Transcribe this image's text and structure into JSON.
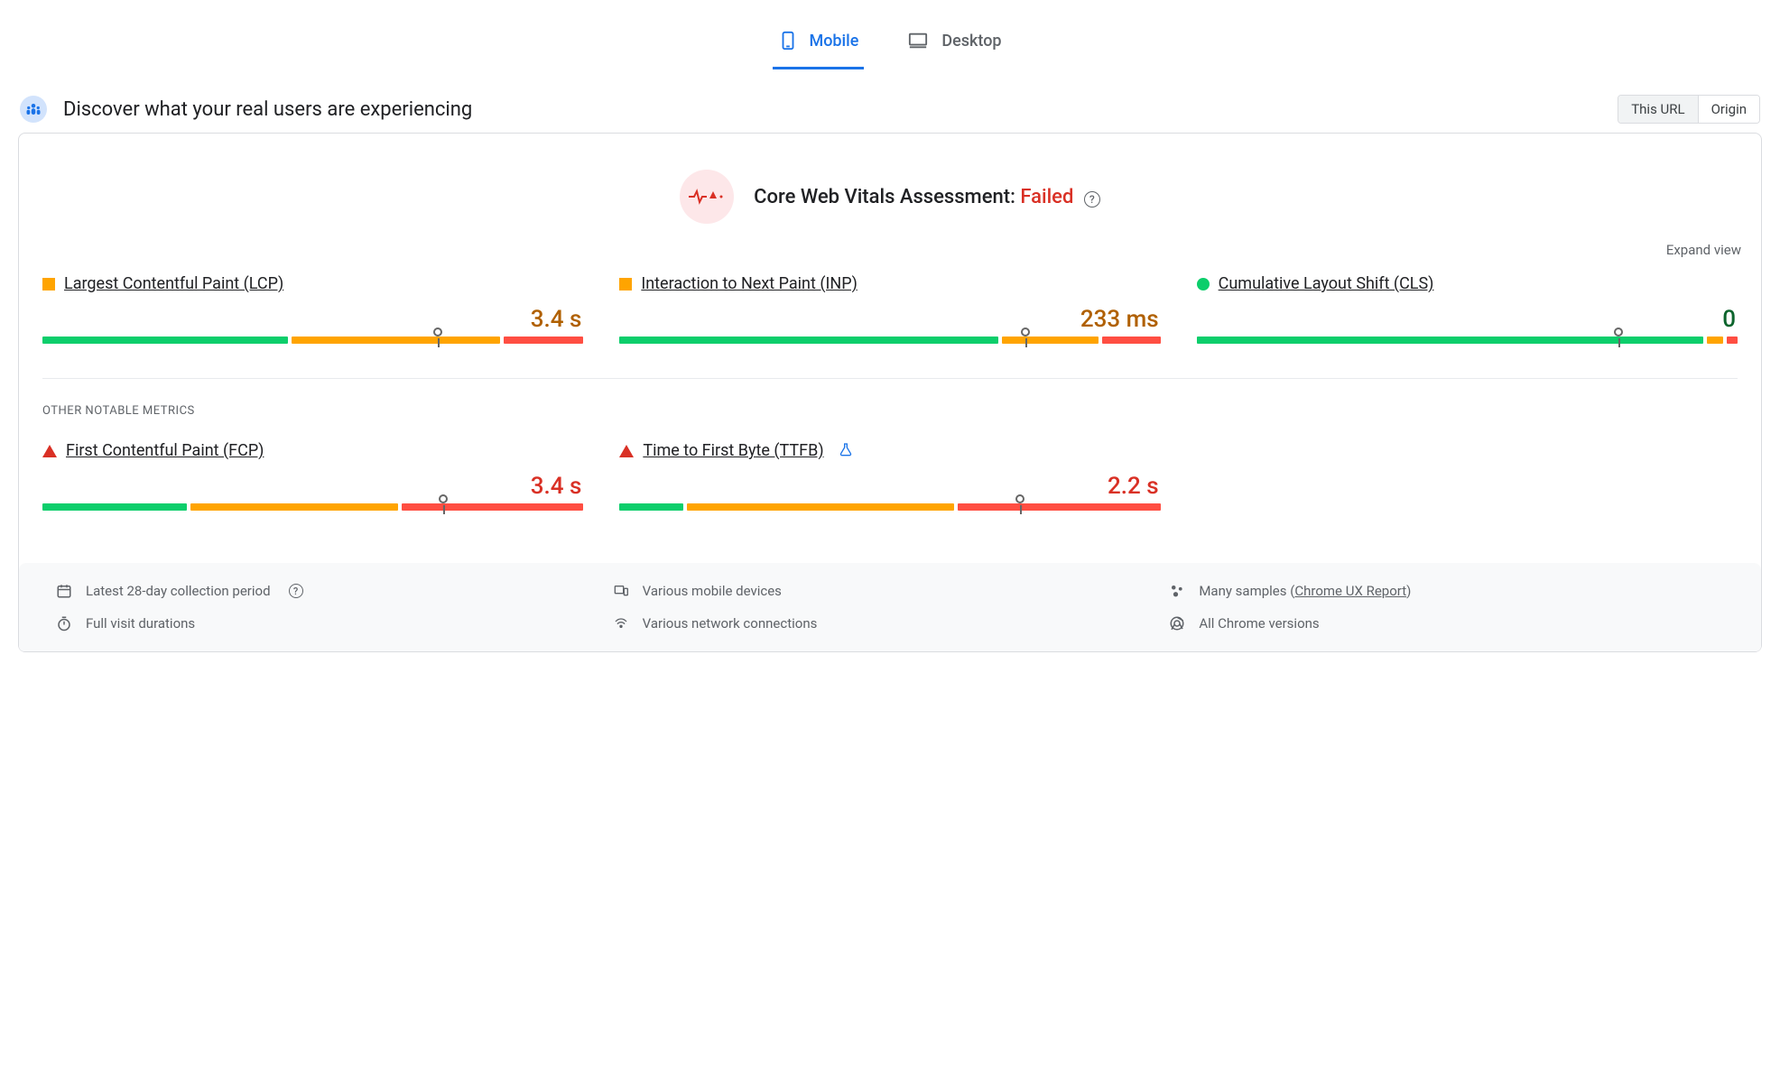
{
  "tabs": {
    "mobile": "Mobile",
    "desktop": "Desktop",
    "active": "mobile"
  },
  "header": {
    "title": "Discover what your real users are experiencing",
    "seg_this_url": "This URL",
    "seg_origin": "Origin",
    "seg_active": "this_url"
  },
  "assessment": {
    "label": "Core Web Vitals Assessment:",
    "status": "Failed",
    "status_color": "#d93025",
    "expand": "Expand view"
  },
  "core_metrics": [
    {
      "name": "Largest Contentful Paint (LCP)",
      "value": "3.4 s",
      "status": "needs-improvement",
      "value_class": "val-amber",
      "bar": {
        "green": 46,
        "amber": 39,
        "red": 15
      },
      "marker_pct": 73
    },
    {
      "name": "Interaction to Next Paint (INP)",
      "value": "233 ms",
      "status": "needs-improvement",
      "value_class": "val-amber",
      "bar": {
        "green": 71,
        "amber": 18,
        "red": 11
      },
      "marker_pct": 75
    },
    {
      "name": "Cumulative Layout Shift (CLS)",
      "value": "0",
      "status": "good",
      "value_class": "val-green",
      "bar": {
        "green": 95,
        "amber": 3,
        "red": 2
      },
      "marker_pct": 78
    }
  ],
  "other_label": "OTHER NOTABLE METRICS",
  "other_metrics": [
    {
      "name": "First Contentful Paint (FCP)",
      "value": "3.4 s",
      "status": "poor",
      "value_class": "val-red",
      "bar": {
        "green": 27,
        "amber": 39,
        "red": 34
      },
      "marker_pct": 74,
      "experimental": false
    },
    {
      "name": "Time to First Byte (TTFB)",
      "value": "2.2 s",
      "status": "poor",
      "value_class": "val-red",
      "bar": {
        "green": 12,
        "amber": 50,
        "red": 38
      },
      "marker_pct": 74,
      "experimental": true
    }
  ],
  "footer": {
    "period": "Latest 28-day collection period",
    "devices": "Various mobile devices",
    "samples_prefix": "Many samples (",
    "samples_link": "Chrome UX Report",
    "samples_suffix": ")",
    "durations": "Full visit durations",
    "network": "Various network connections",
    "chrome": "All Chrome versions"
  },
  "colors": {
    "green": "#0cce6b",
    "amber": "#ffa400",
    "red": "#ff4e42",
    "blue": "#1a73e8"
  }
}
